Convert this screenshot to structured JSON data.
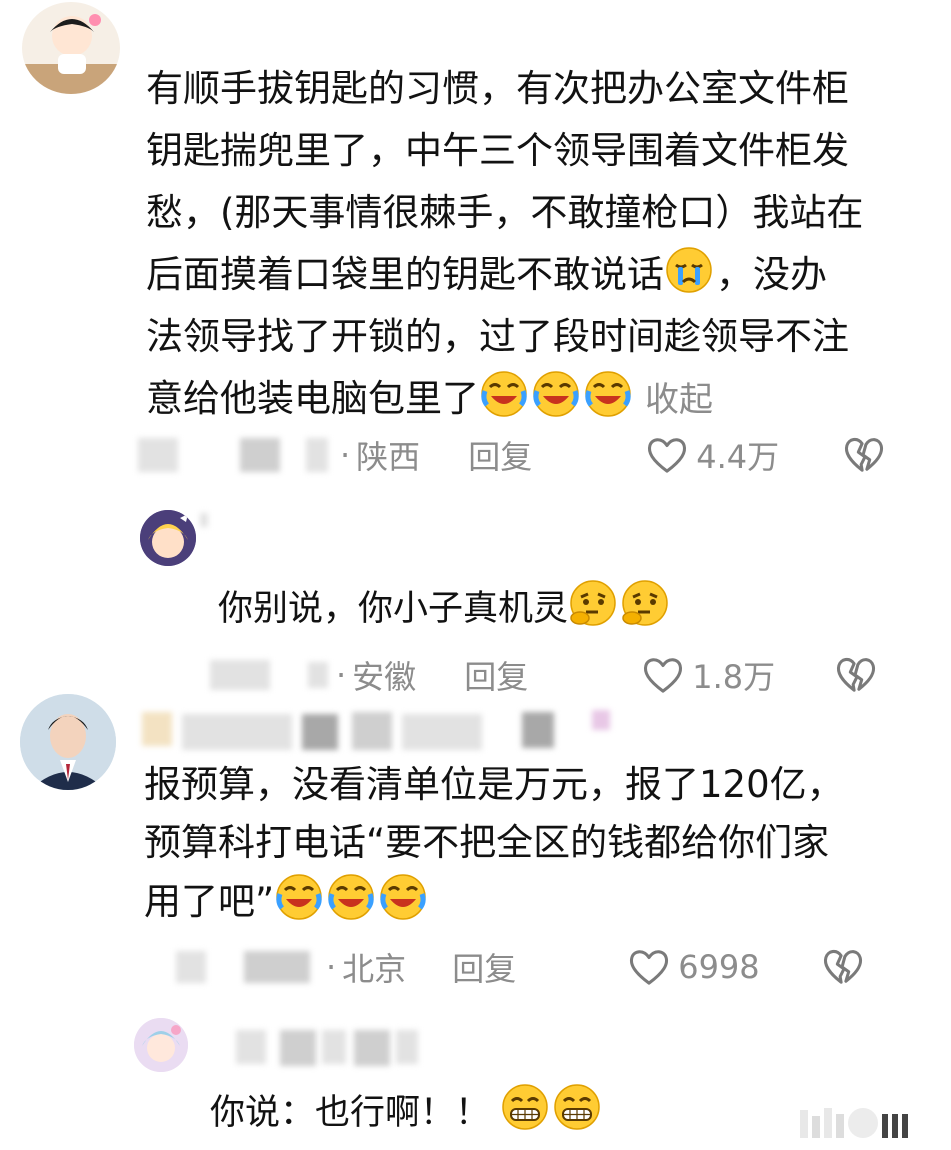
{
  "comments": [
    {
      "text": "有顺手拔钥匙的习惯，有次把办公室文件柜\n钥匙揣兜里了，中午三个领导围着文件柜发\n愁，(那天事情很棘手，不敢撞枪口）我站在\n后面摸着口袋里的钥匙不敢说话",
      "text_tail": "，没办\n法领导找了开锁的，过了段时间趁领导不注\n意给他装电脑包里了",
      "collapse_label": "收起",
      "location": "陕西",
      "reply_label": "回复",
      "likes": "4.4万",
      "reply": {
        "text": "你别说，你小子真机灵",
        "location": "安徽",
        "reply_label": "回复",
        "likes": "1.8万"
      }
    },
    {
      "text": "报预算，没看清单位是万元，报了120亿，\n预算科打电话“要不把全区的钱都给你们家\n用了吧”",
      "location": "北京",
      "reply_label": "回复",
      "likes": "6998",
      "reply": {
        "text": "你说：也行啊！！"
      }
    }
  ],
  "icons": {
    "like": "heart-outline-icon",
    "dislike": "broken-heart-icon",
    "emoji_cry": "crying-face-icon",
    "emoji_laugh": "laughing-tears-icon",
    "emoji_think": "thinking-face-icon",
    "emoji_grin": "grinning-face-icon"
  }
}
